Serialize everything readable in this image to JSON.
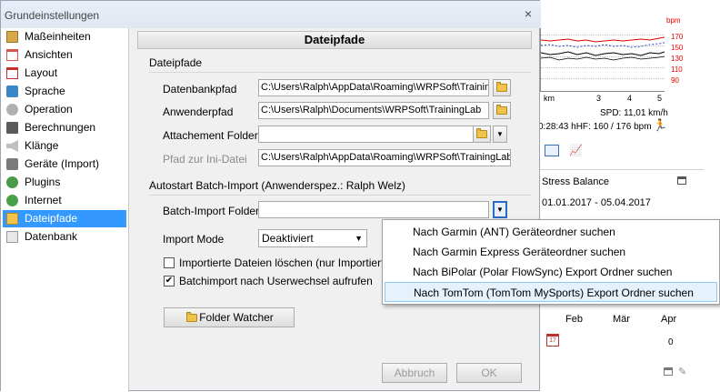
{
  "dialog": {
    "title": "Grundeinstellungen",
    "close_glyph": "×"
  },
  "nav": {
    "items": [
      {
        "label": "Maßeinheiten",
        "icon": "ruler-icon",
        "color": "#d7a94a"
      },
      {
        "label": "Ansichten",
        "icon": "view-icon",
        "color": "#d9534f"
      },
      {
        "label": "Layout",
        "icon": "layout-icon",
        "color": "#c9302c"
      },
      {
        "label": "Sprache",
        "icon": "language-icon",
        "color": "#3a87c8"
      },
      {
        "label": "Operation",
        "icon": "wrench-icon",
        "color": "#8a8a8a"
      },
      {
        "label": "Berechnungen",
        "icon": "calculator-icon",
        "color": "#5a5a5a"
      },
      {
        "label": "Klänge",
        "icon": "speaker-icon",
        "color": "#9a9a9a"
      },
      {
        "label": "Geräte (Import)",
        "icon": "device-icon",
        "color": "#7a7a7a"
      },
      {
        "label": "Plugins",
        "icon": "plugin-icon",
        "color": "#4a9a4a"
      },
      {
        "label": "Internet",
        "icon": "globe-icon",
        "color": "#4aa04a"
      },
      {
        "label": "Dateipfade",
        "icon": "folder-icon",
        "color": "#f0c34a",
        "selected": true
      },
      {
        "label": "Datenbank",
        "icon": "database-icon",
        "color": "#a0a0a0"
      }
    ]
  },
  "panel": {
    "header": "Dateipfade",
    "section_paths": "Dateipfade",
    "fields": {
      "database_label": "Datenbankpfad",
      "database_value": "C:\\Users\\Ralph\\AppData\\Roaming\\WRPSoft\\TrainingLab",
      "user_label": "Anwenderpfad",
      "user_value": "C:\\Users\\Ralph\\Documents\\WRPSoft\\TrainingLab",
      "attachment_label": "Attachement Folder",
      "attachment_value": "",
      "ini_label": "Pfad zur Ini-Datei",
      "ini_value": "C:\\Users\\Ralph\\AppData\\Roaming\\WRPSoft\\TrainingLab\\TrainingLab.ini"
    },
    "section_batch": "Autostart Batch-Import  (Anwenderspez.: Ralph Welz)",
    "batch": {
      "folder_label": "Batch-Import Folder",
      "folder_value": "",
      "mode_label": "Import Mode",
      "mode_value": "Deaktiviert",
      "delete_label": "Importierte Dateien löschen (nur Importierte)",
      "delete_checked": false,
      "userchange_label": "Batchimport nach Userwechsel aufrufen",
      "userchange_checked": true
    },
    "folder_watcher": "Folder Watcher",
    "cancel": "Abbruch",
    "ok": "OK"
  },
  "menu": {
    "items": [
      {
        "label": "Nach Garmin (ANT) Geräteordner suchen"
      },
      {
        "label": "Nach Garmin Express Geräteordner suchen"
      },
      {
        "label": "Nach BiPolar (Polar FlowSync) Export Ordner suchen"
      },
      {
        "label": "Nach TomTom (TomTom MySports) Export Ordner suchen",
        "highlighted": true
      }
    ]
  },
  "background": {
    "bpm_label": "bpm",
    "right_ticks": [
      "170",
      "150",
      "130",
      "110",
      "90"
    ],
    "x_ticks": [
      "km",
      "3",
      "4",
      "5"
    ],
    "spd": "SPD: 11,01 km/h",
    "hf": "0:28:43 hHF: 160 / 176 bpm",
    "stress_title": "Stress Balance",
    "date_range": "01.01.2017 - 05.04.2017",
    "months": [
      "Feb",
      "Mär",
      "Apr"
    ],
    "zero": "0",
    "calendar_day": "17",
    "colors": {
      "red": "#e00000",
      "blue": "#2050c0"
    }
  }
}
